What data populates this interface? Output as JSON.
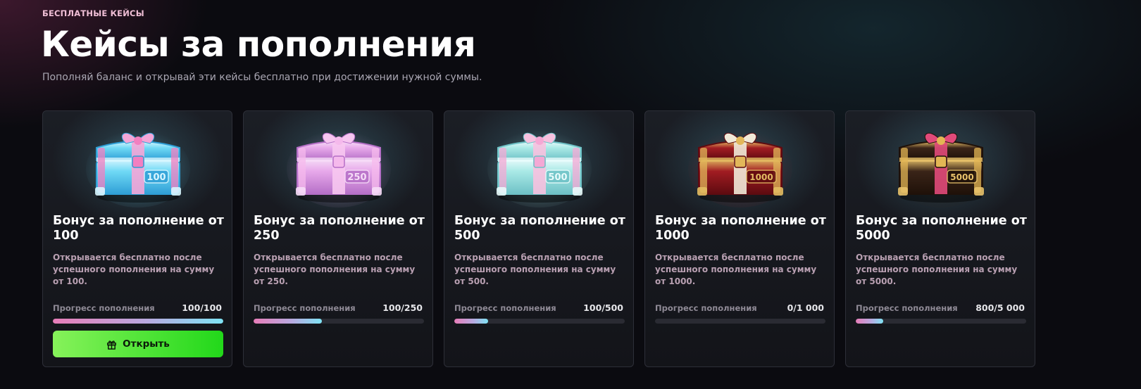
{
  "header": {
    "eyebrow": "БЕСПЛАТНЫЕ КЕЙСЫ",
    "title": "Кейсы за пополнения",
    "subtitle": "Пополняй баланс и открывай эти кейсы бесплатно при достижении нужной суммы."
  },
  "progress_label": "Прогресс пополнения",
  "cards": [
    {
      "title": "Бонус за пополнение от 100",
      "description": "Открывается бесплатно после успешного пополнения на сумму от 100.",
      "progress_text": "100/100",
      "progress": 1.0,
      "chest_label": "100",
      "button_label": "Открыть",
      "button_icon": "gift-icon"
    },
    {
      "title": "Бонус за пополнение от 250",
      "description": "Открывается бесплатно после успешного пополнения на сумму от 250.",
      "progress_text": "100/250",
      "progress": 0.4,
      "chest_label": "250"
    },
    {
      "title": "Бонус за пополнение от 500",
      "description": "Открывается бесплатно после успешного пополнения на сумму от 500.",
      "progress_text": "100/500",
      "progress": 0.2,
      "chest_label": "500"
    },
    {
      "title": "Бонус за пополнение от 1000",
      "description": "Открывается бесплатно после успешного пополнения на сумму от 1000.",
      "progress_text": "0/1 000",
      "progress": 0.0,
      "chest_label": "1000"
    },
    {
      "title": "Бонус за пополнение от 5000",
      "description": "Открывается бесплатно после успешного пополнения на сумму от 5000.",
      "progress_text": "800/5 000",
      "progress": 0.16,
      "chest_label": "5000"
    }
  ],
  "chest_colors": [
    {
      "body": "#6fd9f5",
      "dark": "#2f9fd6",
      "accent": "#f27fc0",
      "ribbon": "#f4a6d7",
      "trim": "#d8f6ff"
    },
    {
      "body": "#e7a8ea",
      "dark": "#b56fc7",
      "accent": "#f5b9ec",
      "ribbon": "#f7c6f0",
      "trim": "#f6dcf7"
    },
    {
      "body": "#a9e9e6",
      "dark": "#6ec1c6",
      "accent": "#f4a8d4",
      "ribbon": "#f7c1df",
      "trim": "#e8fbfb"
    },
    {
      "body": "#a11c22",
      "dark": "#5e0b10",
      "accent": "#e2b75a",
      "ribbon": "#f1ead8",
      "trim": "#e3bc62"
    },
    {
      "body": "#3a2418",
      "dark": "#1f1109",
      "accent": "#e3b654",
      "ribbon": "#e14a7a",
      "trim": "#e8c26a"
    }
  ]
}
